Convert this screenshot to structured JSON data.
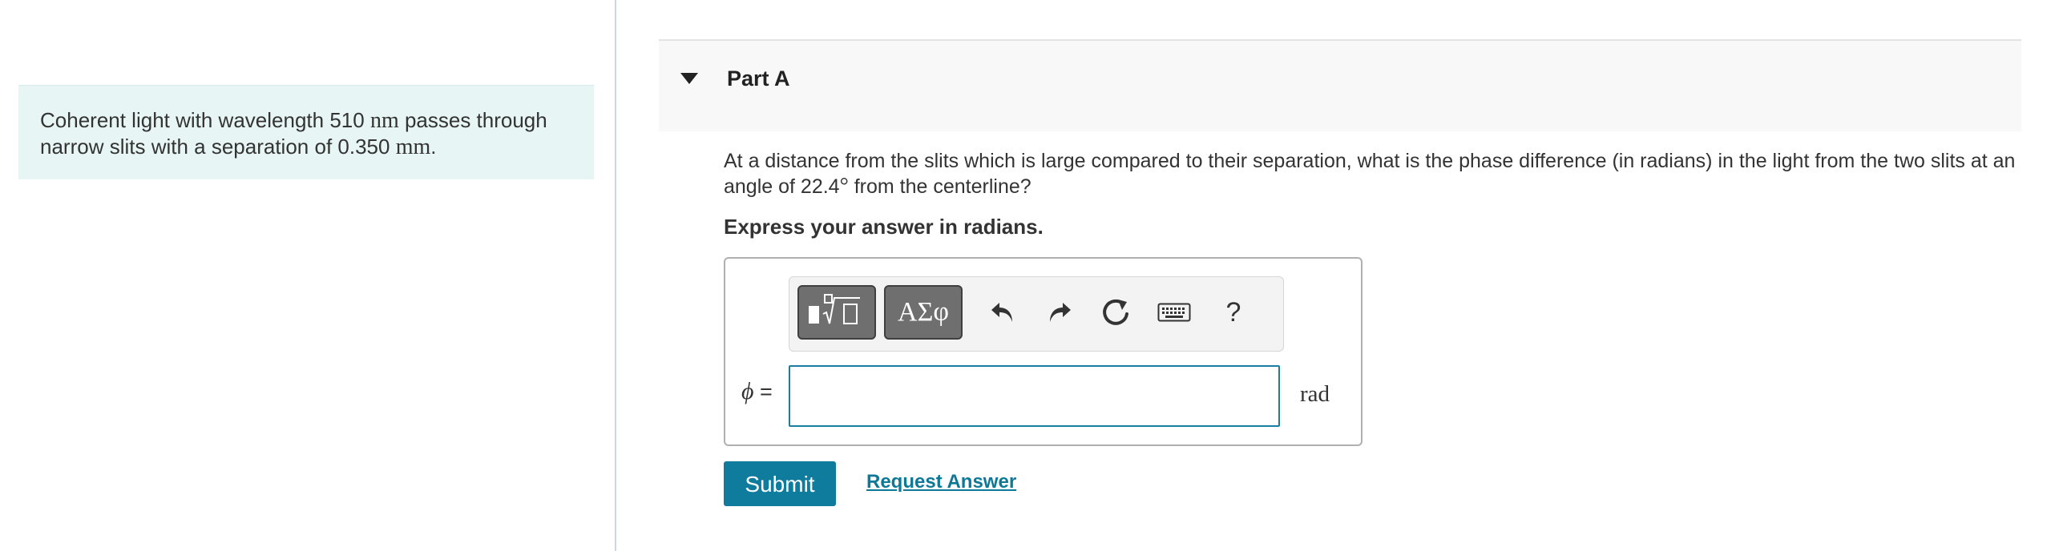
{
  "intro": {
    "text_before_unit1": "Coherent light with wavelength 510 ",
    "unit1": "nm",
    "text_after_unit1": " passes through narrow slits with a separation of 0.350 ",
    "unit2": "mm",
    "text_end": "."
  },
  "part": {
    "title": "Part A"
  },
  "question": {
    "text_before_angle": "At a distance from the slits which is large compared to their separation, what is the phase difference (in radians) in the light from the two slits at an angle of 22.4",
    "degree": "°",
    "text_after_angle": " from the centerline?"
  },
  "instruction": "Express your answer in radians.",
  "toolbar": {
    "greek_label": "ΑΣφ",
    "help_label": "?"
  },
  "answer": {
    "variable": "ϕ",
    "equals": " =",
    "value": "",
    "unit": "rad"
  },
  "actions": {
    "submit_label": "Submit",
    "request_label": "Request Answer"
  },
  "colors": {
    "accent": "#0f7c9e",
    "intro_bg": "#e8f5f5",
    "input_border": "#1a7ea4"
  },
  "icons": [
    "caret-down-icon",
    "templates-icon",
    "undo-icon",
    "redo-icon",
    "reset-icon",
    "keyboard-icon"
  ]
}
